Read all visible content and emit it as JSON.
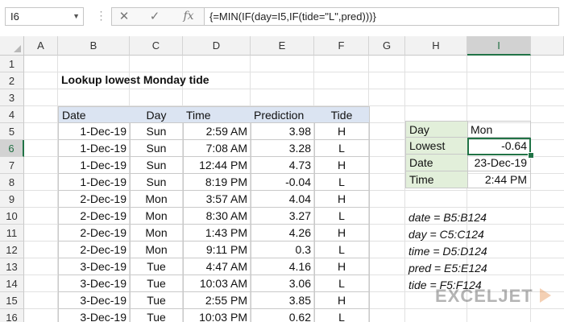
{
  "formula_bar": {
    "name_box": "I6",
    "cancel_icon": "✕",
    "enter_icon": "✓",
    "fx_label": "fx",
    "formula": "{=MIN(IF(day=I5,IF(tide=\"L\",pred)))}"
  },
  "columns": [
    "A",
    "B",
    "C",
    "D",
    "E",
    "F",
    "G",
    "H",
    "I"
  ],
  "selected_column": "I",
  "rows": [
    "1",
    "2",
    "3",
    "4",
    "5",
    "6",
    "7",
    "8",
    "9",
    "10",
    "11",
    "12",
    "13",
    "14",
    "15",
    "16"
  ],
  "selected_row": "6",
  "title": "Lookup lowest Monday tide",
  "table": {
    "headers": [
      "Date",
      "Day",
      "Time",
      "Prediction",
      "Tide"
    ],
    "rows": [
      [
        "1-Dec-19",
        "Sun",
        "2:59 AM",
        "3.98",
        "H"
      ],
      [
        "1-Dec-19",
        "Sun",
        "7:08 AM",
        "3.28",
        "L"
      ],
      [
        "1-Dec-19",
        "Sun",
        "12:44 PM",
        "4.73",
        "H"
      ],
      [
        "1-Dec-19",
        "Sun",
        "8:19 PM",
        "-0.04",
        "L"
      ],
      [
        "2-Dec-19",
        "Mon",
        "3:57 AM",
        "4.04",
        "H"
      ],
      [
        "2-Dec-19",
        "Mon",
        "8:30 AM",
        "3.27",
        "L"
      ],
      [
        "2-Dec-19",
        "Mon",
        "1:43 PM",
        "4.26",
        "H"
      ],
      [
        "2-Dec-19",
        "Mon",
        "9:11 PM",
        "0.3",
        "L"
      ],
      [
        "3-Dec-19",
        "Tue",
        "4:47 AM",
        "4.16",
        "H"
      ],
      [
        "3-Dec-19",
        "Tue",
        "10:03 AM",
        "3.06",
        "L"
      ],
      [
        "3-Dec-19",
        "Tue",
        "2:55 PM",
        "3.85",
        "H"
      ],
      [
        "3-Dec-19",
        "Tue",
        "10:03 PM",
        "0.62",
        "L"
      ]
    ]
  },
  "summary": {
    "day_label": "Day",
    "day_value": "Mon",
    "lowest_label": "Lowest",
    "lowest_value": "-0.64",
    "date_label": "Date",
    "date_value": "23-Dec-19",
    "time_label": "Time",
    "time_value": "2:44 PM"
  },
  "named_ranges": [
    "date = B5:B124",
    "day = C5:C124",
    "time = D5:D124",
    "pred = E5:E124",
    "tide = F5:F124"
  ],
  "logo_text": "EXCELJET",
  "colors": {
    "accent_green": "#217346",
    "table_header_fill": "#dbe4f2",
    "label_fill": "#e2efda"
  }
}
